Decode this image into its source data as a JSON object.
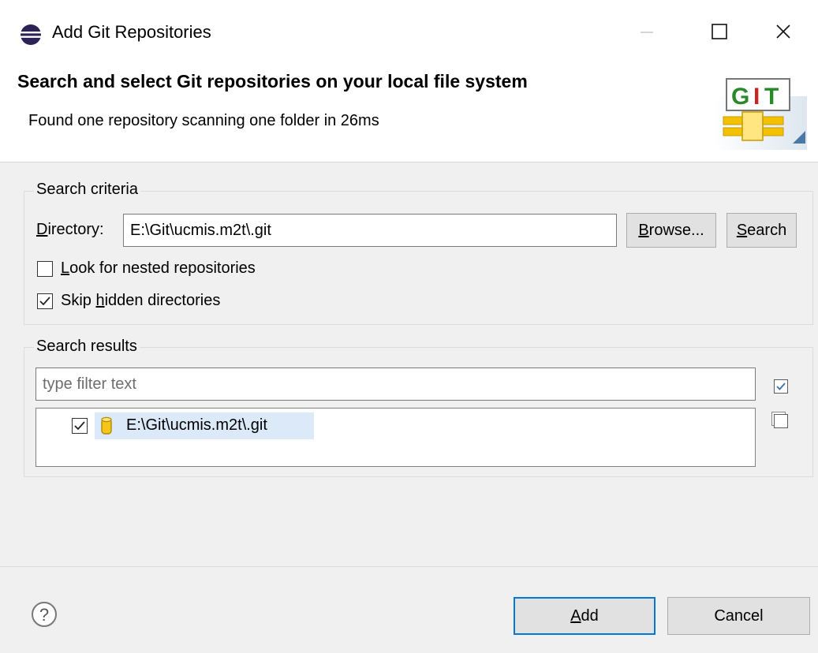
{
  "window": {
    "title": "Add Git Repositories"
  },
  "banner": {
    "title": "Search and select Git repositories on your local file system",
    "description": "Found one repository scanning one folder in 26ms",
    "logo_text_a": "G",
    "logo_text_b": "I",
    "logo_text_c": "T",
    "accent_colors": {
      "git_green": "#2a8a2a",
      "git_red": "#cc2222",
      "pipe_yellow": "#f2c200"
    }
  },
  "search_criteria": {
    "legend": "Search criteria",
    "directory_label_mnemonic": "D",
    "directory_label_rest": "irectory:",
    "directory_value": "E:\\Git\\ucmis.m2t\\.git",
    "browse_label_mnemonic": "B",
    "browse_label_rest": "rowse...",
    "search_label_mnemonic": "S",
    "search_label_rest": "earch",
    "nested_mnemonic": "L",
    "nested_rest": "ook for nested repositories",
    "nested_checked": false,
    "skip_pre": "Skip ",
    "skip_mnemonic": "h",
    "skip_rest": "idden directories",
    "skip_checked": true
  },
  "search_results": {
    "legend": "Search results",
    "filter_placeholder": "type filter text",
    "items": [
      {
        "label": "E:\\Git\\ucmis.m2t\\.git",
        "checked": true
      }
    ]
  },
  "footer": {
    "help_symbol": "?",
    "add_mnemonic": "A",
    "add_rest": "dd",
    "cancel_label": "Cancel"
  }
}
